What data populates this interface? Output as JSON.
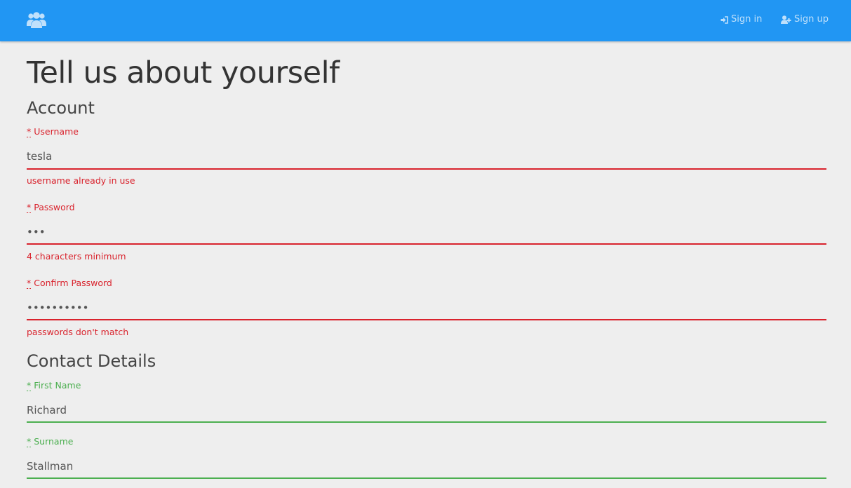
{
  "navbar": {
    "brand_icon": "users-icon",
    "signin_label": "Sign in",
    "signin_icon": "sign-in-icon",
    "signup_label": "Sign up",
    "signup_icon": "user-plus-icon"
  },
  "page": {
    "title": "Tell us about yourself"
  },
  "account": {
    "heading": "Account",
    "username": {
      "required_mark": "*",
      "label": "Username",
      "value": "tesla",
      "error": "username already in use",
      "status": "error"
    },
    "password": {
      "required_mark": "*",
      "label": "Password",
      "value": "abc",
      "error": "4 characters minimum",
      "status": "error"
    },
    "confirm_password": {
      "required_mark": "*",
      "label": "Confirm Password",
      "value": "abcdefghij",
      "error": "passwords don't match",
      "status": "error"
    }
  },
  "contact": {
    "heading": "Contact Details",
    "first_name": {
      "required_mark": "*",
      "label": "First Name",
      "value": "Richard",
      "status": "valid"
    },
    "surname": {
      "required_mark": "*",
      "label": "Surname",
      "value": "Stallman",
      "status": "valid"
    }
  },
  "colors": {
    "navbar": "#2196f3",
    "nav_link": "#bfe0fb",
    "error": "#d9232d",
    "valid": "#4caf50",
    "background": "#eeeeee"
  }
}
